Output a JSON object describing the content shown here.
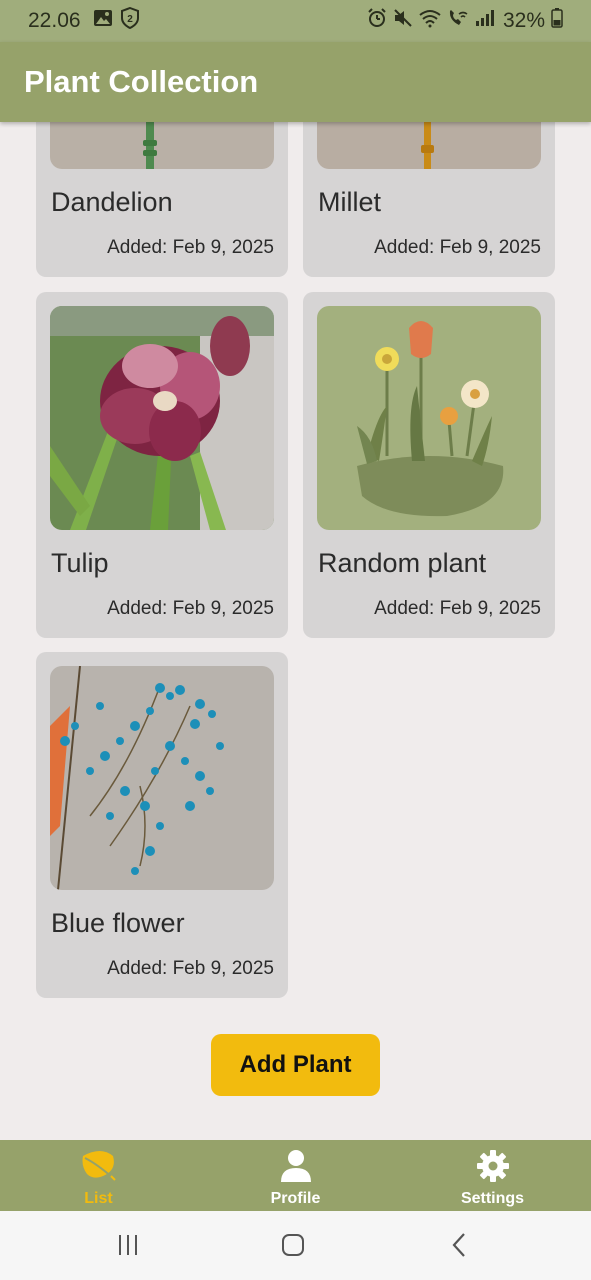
{
  "status_bar": {
    "time": "22.06",
    "battery": "32%",
    "icons": [
      "image-icon",
      "shield-2-icon",
      "alarm-icon",
      "mute-icon",
      "wifi-icon",
      "wifi-call-icon",
      "signal-icon",
      "battery-icon"
    ]
  },
  "app_bar": {
    "title": "Plant Collection"
  },
  "plants": [
    {
      "name": "Dandelion",
      "added": "Added: Feb 9, 2025"
    },
    {
      "name": "Millet",
      "added": "Added: Feb 9, 2025"
    },
    {
      "name": "Tulip",
      "added": "Added: Feb 9, 2025"
    },
    {
      "name": "Random plant",
      "added": "Added: Feb 9, 2025"
    },
    {
      "name": "Blue flower",
      "added": "Added: Feb 9, 2025"
    }
  ],
  "add_button": {
    "label": "Add Plant"
  },
  "bottom_nav": {
    "items": [
      {
        "label": "List",
        "icon": "leaf-icon",
        "active": true
      },
      {
        "label": "Profile",
        "icon": "person-icon",
        "active": false
      },
      {
        "label": "Settings",
        "icon": "gear-icon",
        "active": false
      }
    ]
  },
  "system_nav": {
    "icons": [
      "recent-apps-icon",
      "home-icon",
      "back-icon"
    ]
  },
  "colors": {
    "status_bar": "#a0ad7c",
    "app_bar": "#96a26a",
    "background": "#f0ecec",
    "card": "#d6d4d4",
    "accent": "#f2bb0e"
  }
}
